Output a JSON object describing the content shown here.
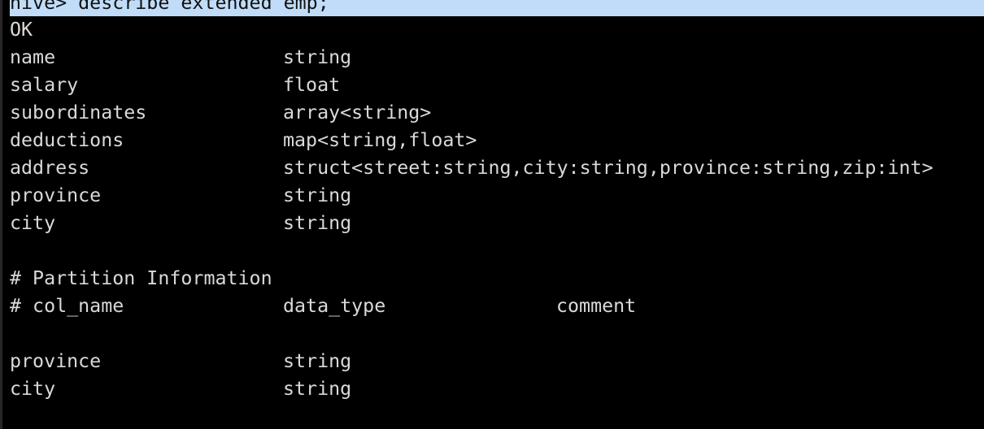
{
  "terminal": {
    "command_line": "hive> describe extended emp;",
    "status": "OK",
    "columns": [
      {
        "name": "name",
        "type": "string"
      },
      {
        "name": "salary",
        "type": "float"
      },
      {
        "name": "subordinates",
        "type": "array<string>"
      },
      {
        "name": "deductions",
        "type": "map<string,float>"
      },
      {
        "name": "address",
        "type": "struct<street:string,city:string,province:string,zip:int>"
      },
      {
        "name": "province",
        "type": "string"
      },
      {
        "name": "city",
        "type": "string"
      }
    ],
    "partition_header": "# Partition Information",
    "partition_col_headers": [
      "# col_name",
      "data_type",
      "comment"
    ],
    "partition_columns": [
      {
        "name": "province",
        "type": "string"
      },
      {
        "name": "city",
        "type": "string"
      }
    ],
    "colors": {
      "background": "#000000",
      "text": "#d9d9d9",
      "selection": "#c0dcf8"
    }
  }
}
